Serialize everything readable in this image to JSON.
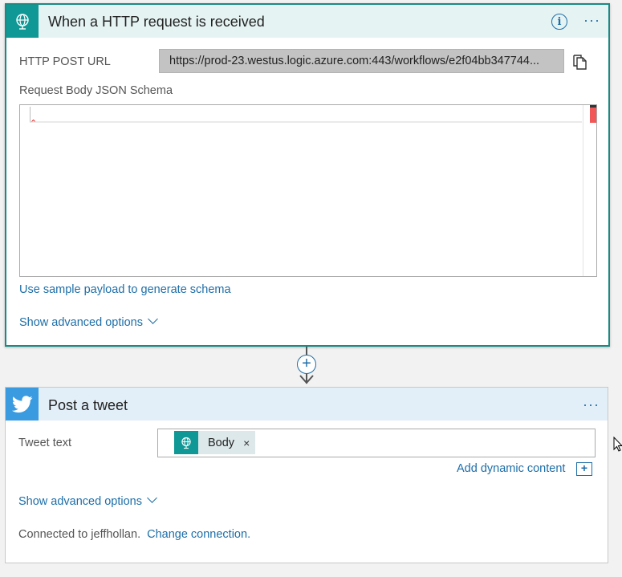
{
  "trigger": {
    "title": "When a HTTP request is received",
    "url_label": "HTTP POST URL",
    "url_value": "https://prod-23.westus.logic.azure.com:443/workflows/e2f04bb347744...",
    "schema_label": "Request Body JSON Schema",
    "sample_link": "Use sample payload to generate schema",
    "advanced_link": "Show advanced options",
    "icon": "http-globe-icon"
  },
  "connector": {
    "add_step_symbol": "+"
  },
  "action": {
    "title": "Post a tweet",
    "icon": "twitter-bird-icon",
    "tweet_label": "Tweet text",
    "token_label": "Body",
    "token_close": "×",
    "dynamic_content_link": "Add dynamic content",
    "dynamic_content_icon": "+",
    "advanced_link": "Show advanced options",
    "connected_text": "Connected to jeffhollan.",
    "change_connection_link": "Change connection."
  },
  "colors": {
    "teal_accent": "#0f9895",
    "twitter_blue": "#3a9be0",
    "link_blue": "#1d6ea8"
  }
}
